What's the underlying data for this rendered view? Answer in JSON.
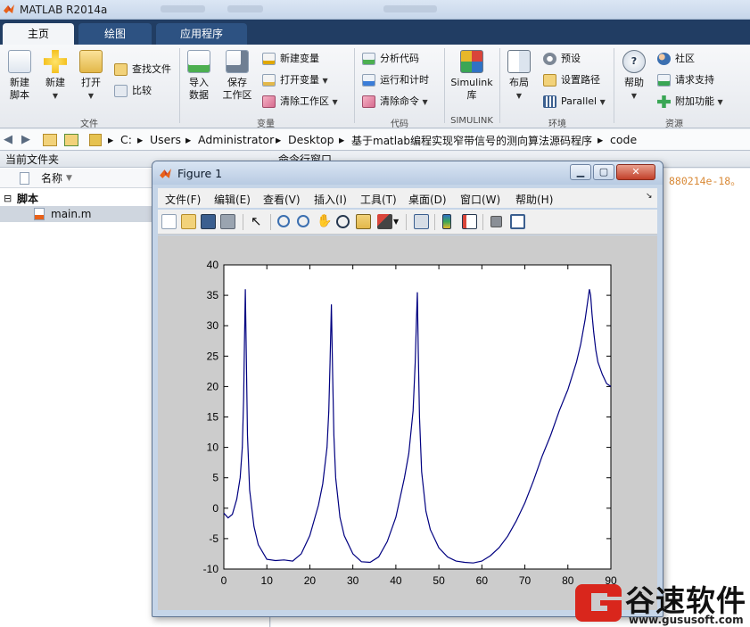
{
  "window": {
    "title": "MATLAB R2014a"
  },
  "ribbon": {
    "tabs": [
      {
        "label": "主页",
        "active": true
      },
      {
        "label": "绘图",
        "active": false
      },
      {
        "label": "应用程序",
        "active": false
      }
    ],
    "file_group": {
      "label": "文件",
      "new_script": "新建\n脚本",
      "new": "新建",
      "open": "打开",
      "find_files": "查找文件",
      "compare": "比较"
    },
    "variable_group": {
      "label": "变量",
      "import": "导入\n数据",
      "save_ws": "保存\n工作区",
      "new_var": "新建变量",
      "open_var": "打开变量",
      "clear_ws": "清除工作区"
    },
    "code_group": {
      "label": "代码",
      "analyze": "分析代码",
      "run_time": "运行和计时",
      "clear_cmd": "清除命令"
    },
    "simulink_group": {
      "label": "SIMULINK",
      "library": "Simulink\n库"
    },
    "env_group": {
      "label": "环境",
      "layout": "布局",
      "prefs": "预设",
      "set_path": "设置路径",
      "parallel": "Parallel"
    },
    "resources_group": {
      "label": "资源",
      "help": "帮助",
      "community": "社区",
      "support": "请求支持",
      "addons": "附加功能"
    }
  },
  "address": {
    "crumbs": [
      "C:",
      "Users",
      "Administrator",
      "Desktop",
      "基于matlab编程实现窄带信号的测向算法源码程序",
      "code"
    ]
  },
  "current_folder": {
    "title": "当前文件夹",
    "column": "名称",
    "group": "脚本",
    "files": [
      "main.m"
    ]
  },
  "command_window": {
    "title": "命令行窗口",
    "visible_text": "880214e-18。"
  },
  "figure": {
    "title": "Figure 1",
    "menu": [
      "文件(F)",
      "编辑(E)",
      "查看(V)",
      "插入(I)",
      "工具(T)",
      "桌面(D)",
      "窗口(W)",
      "帮助(H)"
    ],
    "tools": [
      "new-figure-icon",
      "open-icon",
      "save-icon",
      "print-icon",
      "pointer-icon",
      "zoom-in-icon",
      "zoom-out-icon",
      "pan-icon",
      "rotate-icon",
      "data-cursor-icon",
      "brush-icon",
      "link-icon",
      "colorbar-icon",
      "legend-icon",
      "hide-plot-tools-icon",
      "show-plot-tools-icon"
    ]
  },
  "chart_data": {
    "type": "line",
    "xlim": [
      0,
      90
    ],
    "ylim": [
      -10,
      40
    ],
    "xticks": [
      0,
      10,
      20,
      30,
      40,
      50,
      60,
      70,
      80,
      90
    ],
    "yticks": [
      -10,
      -5,
      0,
      5,
      10,
      15,
      20,
      25,
      30,
      35,
      40
    ],
    "grid": false,
    "color": "#000080",
    "series": [
      {
        "x": [
          0,
          1,
          2,
          3,
          3.8,
          4.3,
          4.6,
          4.8,
          5,
          5.2,
          5.5,
          6,
          7,
          8,
          10,
          12,
          14,
          16,
          18,
          20,
          22,
          23,
          24,
          24.4,
          24.7,
          25,
          25.3,
          25.6,
          26,
          27,
          28,
          30,
          32,
          34,
          36,
          38,
          40,
          42,
          43,
          44,
          44.5,
          44.8,
          45,
          45.2,
          45.5,
          46,
          47,
          48,
          50,
          52,
          54,
          56,
          58,
          60,
          62,
          64,
          66,
          68,
          70,
          72,
          74,
          76,
          78,
          80,
          82,
          83,
          84,
          84.6,
          85,
          85.3,
          85.6,
          86,
          86.5,
          87,
          88,
          89,
          90
        ],
        "y": [
          -0.8,
          -1.6,
          -1,
          1.5,
          5,
          10,
          18,
          27,
          36,
          26,
          12,
          3,
          -3,
          -6,
          -8.4,
          -8.6,
          -8.5,
          -8.7,
          -7.5,
          -4.5,
          0.5,
          4,
          10,
          16,
          24,
          33.5,
          22,
          12,
          5,
          -1.5,
          -4.5,
          -7.5,
          -8.8,
          -8.9,
          -8,
          -5.5,
          -1.5,
          5,
          9,
          16,
          24,
          31,
          35.5,
          26,
          15,
          6,
          -0.5,
          -3.5,
          -6.5,
          -8,
          -8.7,
          -8.9,
          -9,
          -8.7,
          -7.8,
          -6.5,
          -4.6,
          -2.1,
          0.9,
          4.5,
          8.5,
          12,
          16,
          19.5,
          24,
          27,
          31,
          34,
          36,
          35,
          32,
          29,
          26,
          24,
          22,
          20.5,
          20
        ]
      }
    ]
  },
  "watermark": {
    "brand": "谷速软件",
    "url": "www.gususoft.com",
    "accent": "#d9261c"
  }
}
